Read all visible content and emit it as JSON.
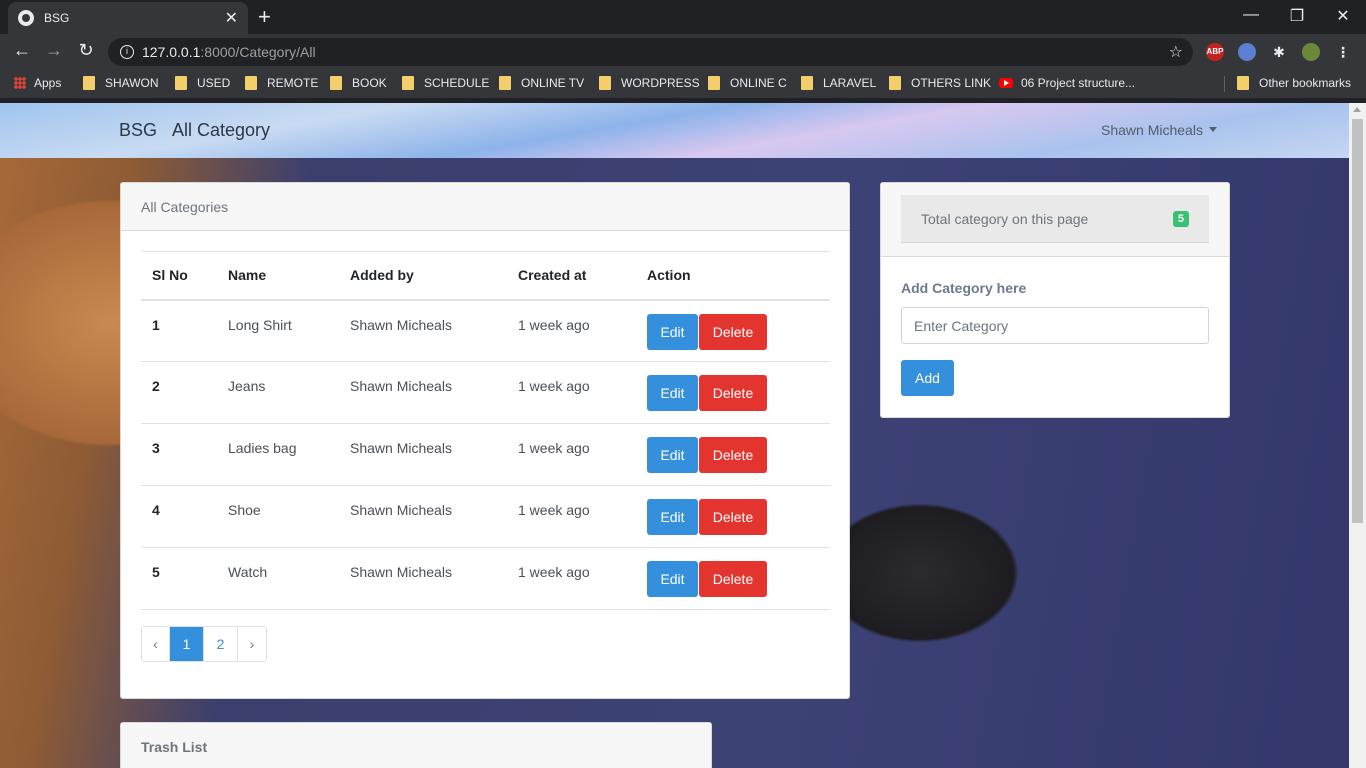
{
  "browser": {
    "tab_title": "BSG",
    "url_host": "127.0.0.1",
    "url_path": ":8000/Category/All",
    "new_tab_symbol": "+",
    "extensions": [
      "ABP"
    ],
    "bookmarks": [
      "Apps",
      "SHAWON",
      "USED",
      "REMOTE",
      "BOOK",
      "SCHEDULE",
      "ONLINE TV",
      "WORDPRESS",
      "ONLINE C",
      "LARAVEL",
      "OTHERS LINK",
      "06 Project structure...",
      "Other bookmarks"
    ]
  },
  "navbar": {
    "brand": "BSG",
    "title": "All Category",
    "user": "Shawn Micheals"
  },
  "main": {
    "header": "All Categories",
    "columns": [
      "Sl No",
      "Name",
      "Added by",
      "Created at",
      "Action"
    ],
    "rows": [
      {
        "sl": "1",
        "name": "Long Shirt",
        "added_by": "Shawn Micheals",
        "created": "1 week ago"
      },
      {
        "sl": "2",
        "name": "Jeans",
        "added_by": "Shawn Micheals",
        "created": "1 week ago"
      },
      {
        "sl": "3",
        "name": "Ladies bag",
        "added_by": "Shawn Micheals",
        "created": "1 week ago"
      },
      {
        "sl": "4",
        "name": "Shoe",
        "added_by": "Shawn Micheals",
        "created": "1 week ago"
      },
      {
        "sl": "5",
        "name": "Watch",
        "added_by": "Shawn Micheals",
        "created": "1 week ago"
      }
    ],
    "edit_label": "Edit",
    "delete_label": "Delete",
    "pagination": {
      "prev": "‹",
      "pages": [
        "1",
        "2"
      ],
      "next": "›",
      "active": "1"
    }
  },
  "side": {
    "total_label": "Total category on this page",
    "total_count": "5",
    "add_label": "Add Category here",
    "input_placeholder": "Enter Category",
    "add_button": "Add"
  },
  "trash": {
    "header": "Trash List"
  },
  "colors": {
    "primary": "#3490dc",
    "danger": "#e3342f",
    "success": "#38c172"
  }
}
